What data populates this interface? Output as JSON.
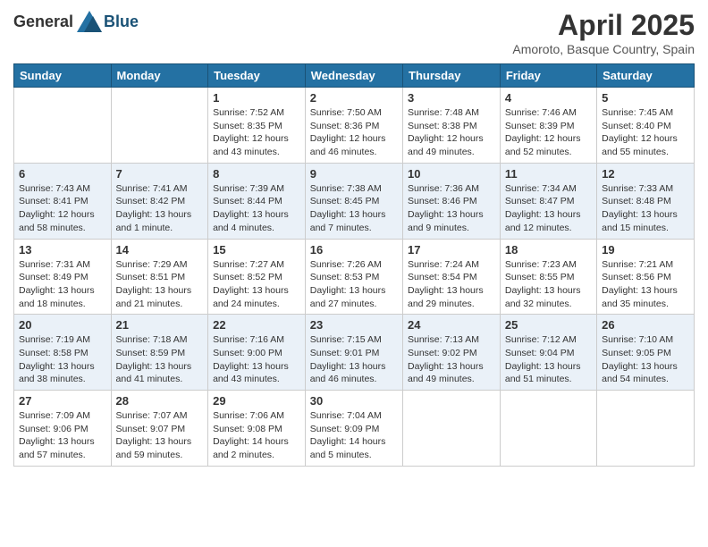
{
  "header": {
    "logo_general": "General",
    "logo_blue": "Blue",
    "month_year": "April 2025",
    "location": "Amoroto, Basque Country, Spain"
  },
  "days_of_week": [
    "Sunday",
    "Monday",
    "Tuesday",
    "Wednesday",
    "Thursday",
    "Friday",
    "Saturday"
  ],
  "weeks": [
    [
      {
        "day": "",
        "info": ""
      },
      {
        "day": "",
        "info": ""
      },
      {
        "day": "1",
        "info": "Sunrise: 7:52 AM\nSunset: 8:35 PM\nDaylight: 12 hours and 43 minutes."
      },
      {
        "day": "2",
        "info": "Sunrise: 7:50 AM\nSunset: 8:36 PM\nDaylight: 12 hours and 46 minutes."
      },
      {
        "day": "3",
        "info": "Sunrise: 7:48 AM\nSunset: 8:38 PM\nDaylight: 12 hours and 49 minutes."
      },
      {
        "day": "4",
        "info": "Sunrise: 7:46 AM\nSunset: 8:39 PM\nDaylight: 12 hours and 52 minutes."
      },
      {
        "day": "5",
        "info": "Sunrise: 7:45 AM\nSunset: 8:40 PM\nDaylight: 12 hours and 55 minutes."
      }
    ],
    [
      {
        "day": "6",
        "info": "Sunrise: 7:43 AM\nSunset: 8:41 PM\nDaylight: 12 hours and 58 minutes."
      },
      {
        "day": "7",
        "info": "Sunrise: 7:41 AM\nSunset: 8:42 PM\nDaylight: 13 hours and 1 minute."
      },
      {
        "day": "8",
        "info": "Sunrise: 7:39 AM\nSunset: 8:44 PM\nDaylight: 13 hours and 4 minutes."
      },
      {
        "day": "9",
        "info": "Sunrise: 7:38 AM\nSunset: 8:45 PM\nDaylight: 13 hours and 7 minutes."
      },
      {
        "day": "10",
        "info": "Sunrise: 7:36 AM\nSunset: 8:46 PM\nDaylight: 13 hours and 9 minutes."
      },
      {
        "day": "11",
        "info": "Sunrise: 7:34 AM\nSunset: 8:47 PM\nDaylight: 13 hours and 12 minutes."
      },
      {
        "day": "12",
        "info": "Sunrise: 7:33 AM\nSunset: 8:48 PM\nDaylight: 13 hours and 15 minutes."
      }
    ],
    [
      {
        "day": "13",
        "info": "Sunrise: 7:31 AM\nSunset: 8:49 PM\nDaylight: 13 hours and 18 minutes."
      },
      {
        "day": "14",
        "info": "Sunrise: 7:29 AM\nSunset: 8:51 PM\nDaylight: 13 hours and 21 minutes."
      },
      {
        "day": "15",
        "info": "Sunrise: 7:27 AM\nSunset: 8:52 PM\nDaylight: 13 hours and 24 minutes."
      },
      {
        "day": "16",
        "info": "Sunrise: 7:26 AM\nSunset: 8:53 PM\nDaylight: 13 hours and 27 minutes."
      },
      {
        "day": "17",
        "info": "Sunrise: 7:24 AM\nSunset: 8:54 PM\nDaylight: 13 hours and 29 minutes."
      },
      {
        "day": "18",
        "info": "Sunrise: 7:23 AM\nSunset: 8:55 PM\nDaylight: 13 hours and 32 minutes."
      },
      {
        "day": "19",
        "info": "Sunrise: 7:21 AM\nSunset: 8:56 PM\nDaylight: 13 hours and 35 minutes."
      }
    ],
    [
      {
        "day": "20",
        "info": "Sunrise: 7:19 AM\nSunset: 8:58 PM\nDaylight: 13 hours and 38 minutes."
      },
      {
        "day": "21",
        "info": "Sunrise: 7:18 AM\nSunset: 8:59 PM\nDaylight: 13 hours and 41 minutes."
      },
      {
        "day": "22",
        "info": "Sunrise: 7:16 AM\nSunset: 9:00 PM\nDaylight: 13 hours and 43 minutes."
      },
      {
        "day": "23",
        "info": "Sunrise: 7:15 AM\nSunset: 9:01 PM\nDaylight: 13 hours and 46 minutes."
      },
      {
        "day": "24",
        "info": "Sunrise: 7:13 AM\nSunset: 9:02 PM\nDaylight: 13 hours and 49 minutes."
      },
      {
        "day": "25",
        "info": "Sunrise: 7:12 AM\nSunset: 9:04 PM\nDaylight: 13 hours and 51 minutes."
      },
      {
        "day": "26",
        "info": "Sunrise: 7:10 AM\nSunset: 9:05 PM\nDaylight: 13 hours and 54 minutes."
      }
    ],
    [
      {
        "day": "27",
        "info": "Sunrise: 7:09 AM\nSunset: 9:06 PM\nDaylight: 13 hours and 57 minutes."
      },
      {
        "day": "28",
        "info": "Sunrise: 7:07 AM\nSunset: 9:07 PM\nDaylight: 13 hours and 59 minutes."
      },
      {
        "day": "29",
        "info": "Sunrise: 7:06 AM\nSunset: 9:08 PM\nDaylight: 14 hours and 2 minutes."
      },
      {
        "day": "30",
        "info": "Sunrise: 7:04 AM\nSunset: 9:09 PM\nDaylight: 14 hours and 5 minutes."
      },
      {
        "day": "",
        "info": ""
      },
      {
        "day": "",
        "info": ""
      },
      {
        "day": "",
        "info": ""
      }
    ]
  ]
}
